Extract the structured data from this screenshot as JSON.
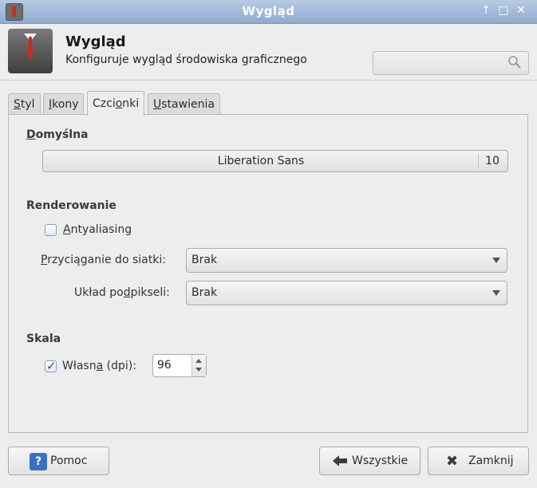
{
  "window": {
    "title": "Wygląd"
  },
  "header": {
    "title": "Wygląd",
    "subtitle": "Konfiguruje wygląd środowiska graficznego",
    "search_placeholder": ""
  },
  "tabs": [
    {
      "label_pre": "",
      "label_u": "S",
      "label_post": "tyl"
    },
    {
      "label_pre": "",
      "label_u": "I",
      "label_post": "kony"
    },
    {
      "label_pre": "Czci",
      "label_u": "o",
      "label_post": "nki"
    },
    {
      "label_pre": "",
      "label_u": "U",
      "label_post": "stawienia"
    }
  ],
  "active_tab": 2,
  "default_section": {
    "heading_u": "D",
    "heading_post": "omyślna",
    "font_name": "Liberation Sans",
    "font_size": "10"
  },
  "rendering": {
    "heading": "Renderowanie",
    "antialiasing_u": "A",
    "antialiasing_post": "ntyaliasing",
    "antialiasing_checked": false,
    "hinting_label_pre": "",
    "hinting_label_u": "P",
    "hinting_label_post": "rzyciąganie do siatki:",
    "hinting_value": "Brak",
    "subpixel_label_pre": "Układ po",
    "subpixel_label_u": "d",
    "subpixel_label_post": "pikseli:",
    "subpixel_value": "Brak"
  },
  "scale": {
    "heading": "Skala",
    "custom_pre": "Własn",
    "custom_u": "a",
    "custom_post": " (dpi):",
    "custom_checked": true,
    "dpi_value": "96"
  },
  "buttons": {
    "help": "Pomoc",
    "all": "Wszystkie",
    "close": "Zamknij"
  }
}
